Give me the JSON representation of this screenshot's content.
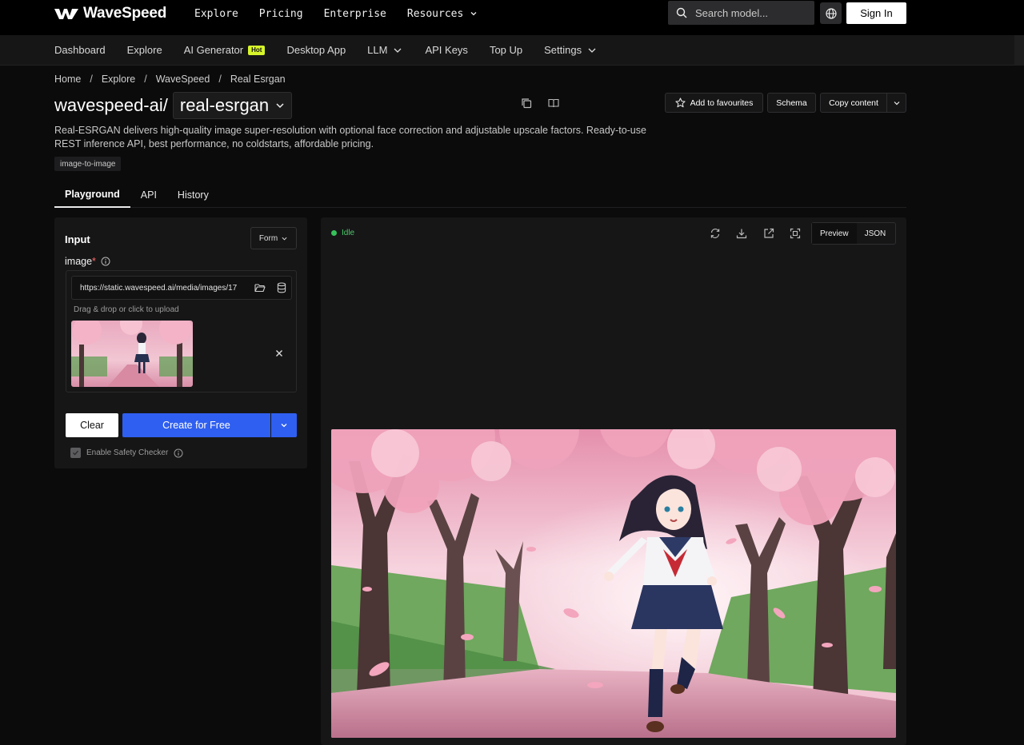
{
  "brand": {
    "name": "WaveSpeed"
  },
  "topnav": {
    "items": [
      {
        "label": "Explore",
        "dropdown": false
      },
      {
        "label": "Pricing",
        "dropdown": false
      },
      {
        "label": "Enterprise",
        "dropdown": false
      },
      {
        "label": "Resources",
        "dropdown": true
      }
    ],
    "search_placeholder": "Search model...",
    "signin_label": "Sign In"
  },
  "subnav": {
    "items": [
      {
        "label": "Dashboard"
      },
      {
        "label": "Explore"
      },
      {
        "label": "AI Generator",
        "badge": "Hot"
      },
      {
        "label": "Desktop App"
      },
      {
        "label": "LLM",
        "dropdown": true
      },
      {
        "label": "API Keys"
      },
      {
        "label": "Top Up"
      },
      {
        "label": "Settings",
        "dropdown": true
      }
    ]
  },
  "breadcrumb": [
    "Home",
    "Explore",
    "WaveSpeed",
    "Real Esrgan"
  ],
  "model": {
    "owner": "wavespeed-ai/",
    "name": "real-esrgan",
    "description": "Real-ESRGAN delivers high-quality image super-resolution with optional face correction and adjustable upscale factors. Ready-to-use REST inference API, best performance, no coldstarts, affordable pricing.",
    "tag": "image-to-image"
  },
  "actions": {
    "favourite": "Add to favourites",
    "schema": "Schema",
    "copy": "Copy content"
  },
  "tabs": [
    {
      "label": "Playground",
      "active": true
    },
    {
      "label": "API",
      "active": false
    },
    {
      "label": "History",
      "active": false
    }
  ],
  "input": {
    "title": "Input",
    "mode": "Form",
    "image_label": "image",
    "required_mark": "*",
    "image_url": "https://static.wavespeed.ai/media/images/17",
    "drop_hint": "Drag & drop or click to upload",
    "clear_label": "Clear",
    "create_label": "Create for Free",
    "safety_label": "Enable Safety Checker",
    "safety_checked": true
  },
  "output": {
    "status": "Idle",
    "view_options": [
      "Preview",
      "JSON"
    ],
    "active_view": "Preview"
  },
  "colors": {
    "accent": "#2f5ff0",
    "status_idle": "#36c25a",
    "hot_badge": "#d7f52a"
  }
}
